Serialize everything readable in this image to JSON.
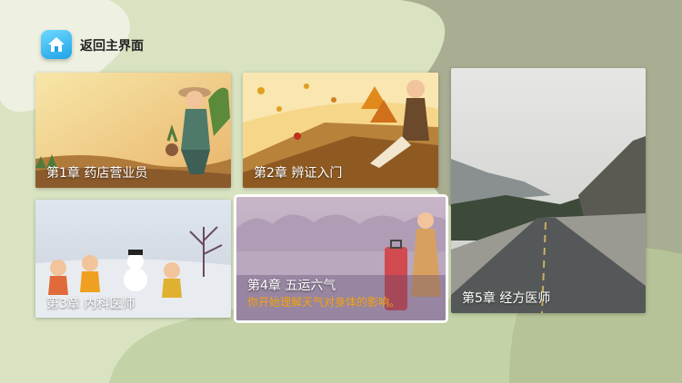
{
  "header": {
    "home_label": "返回主界面"
  },
  "chapters": [
    {
      "title": "第1章  药店营业员"
    },
    {
      "title": "第2章  辨证入门"
    },
    {
      "title": "第3章  内科医师"
    },
    {
      "title": "第4章  五运六气",
      "subtitle": "你开始理解天气对身体的影响。"
    },
    {
      "title": "第5章  经方医师"
    }
  ],
  "colors": {
    "accent": "#f4a20c",
    "background": "#a9ae92",
    "home_icon": "#1ea3e8"
  },
  "icons": {
    "home": "home-icon"
  }
}
